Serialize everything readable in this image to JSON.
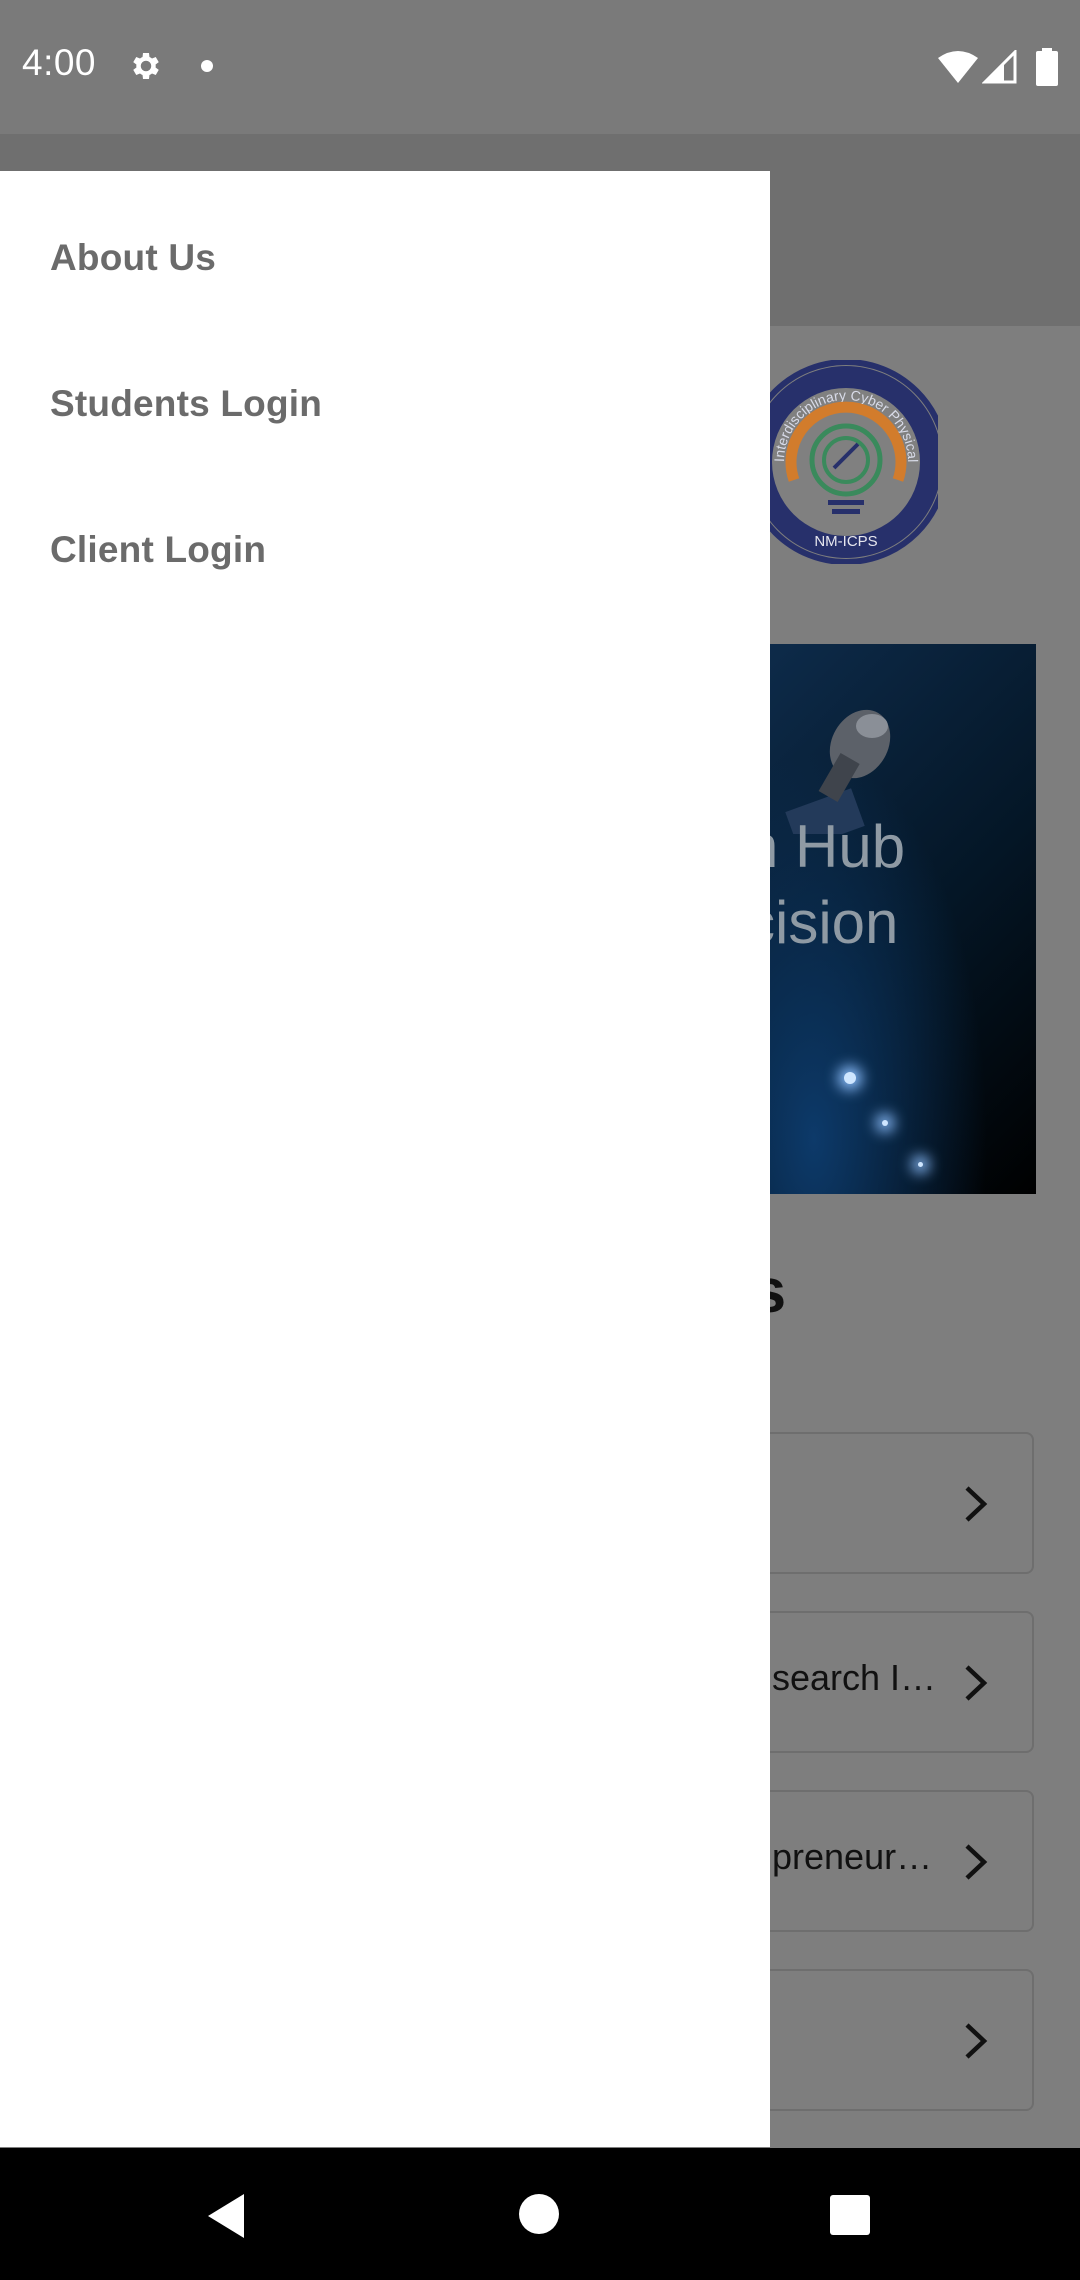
{
  "status_bar": {
    "time": "4:00",
    "icons": [
      "gear-icon",
      "notification-dot-icon",
      "wifi-icon",
      "cell-signal-icon",
      "battery-icon"
    ]
  },
  "drawer": {
    "items": [
      {
        "label": "About Us"
      },
      {
        "label": "Students Login"
      },
      {
        "label": "Client Login"
      }
    ]
  },
  "background": {
    "logo": {
      "ring_text": "Interdisciplinary Cyber Physical Systems",
      "bottom_text": "NM-ICPS"
    },
    "banner": {
      "line1": "n Hub",
      "line2": "cision"
    },
    "section_heading": "ts",
    "cards": [
      {
        "label": ""
      },
      {
        "label": "search I…"
      },
      {
        "label": "preneur…"
      },
      {
        "label": ""
      }
    ]
  },
  "nav_bar": {
    "icons": [
      "back-icon",
      "home-icon",
      "recents-icon"
    ]
  },
  "colors": {
    "scrim": "#7e7e7e",
    "drawer_bg": "#ffffff",
    "drawer_text": "#6b6b6b",
    "logo_navy": "#27306b",
    "logo_orange": "#d27c2c",
    "logo_green": "#3a8a5c"
  }
}
